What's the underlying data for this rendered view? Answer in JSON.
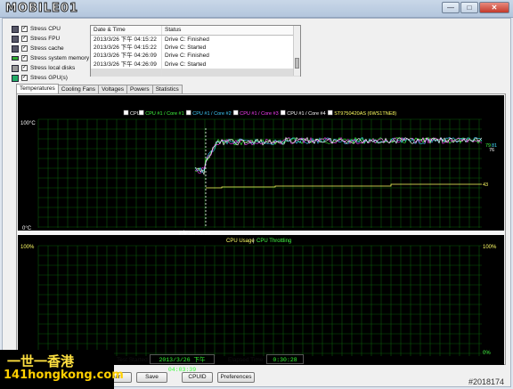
{
  "window": {
    "logo_text": "MOBILE01",
    "btn_min": "—",
    "btn_max": "□",
    "btn_close": "✕"
  },
  "stress": [
    {
      "label": "Stress CPU",
      "icon": "cpu-icon",
      "checked": true
    },
    {
      "label": "Stress FPU",
      "icon": "fpu-icon",
      "checked": true
    },
    {
      "label": "Stress cache",
      "icon": "cache-icon",
      "checked": true
    },
    {
      "label": "Stress system memory",
      "icon": "memory-icon",
      "checked": true
    },
    {
      "label": "Stress local disks",
      "icon": "disk-icon",
      "checked": true
    },
    {
      "label": "Stress GPU(s)",
      "icon": "gpu-icon",
      "checked": true
    }
  ],
  "log": {
    "headers": [
      "Date & Time",
      "Status"
    ],
    "rows": [
      [
        "2013/3/26 下午 04:15:22",
        "Drive C: Finished"
      ],
      [
        "2013/3/26 下午 04:15:22",
        "Drive C: Started"
      ],
      [
        "2013/3/26 下午 04:26:09",
        "Drive C: Finished"
      ],
      [
        "2013/3/26 下午 04:26:09",
        "Drive C: Started"
      ],
      [
        "",
        ""
      ]
    ]
  },
  "tabs": [
    "Temperatures",
    "Cooling Fans",
    "Voltages",
    "Powers",
    "Statistics"
  ],
  "temp_chart": {
    "legend": [
      {
        "label": "CPU",
        "color": "#ffffff"
      },
      {
        "label": "CPU #1 / Core #1",
        "color": "#40ff40"
      },
      {
        "label": "CPU #1 / Core #2",
        "color": "#40d0ff"
      },
      {
        "label": "CPU #1 / Core #3",
        "color": "#ff40ff"
      },
      {
        "label": "CPU #1 / Core #4",
        "color": "#ffffff"
      },
      {
        "label": "ST9750420AS (6WS1TNE8)",
        "color": "#ffff60"
      }
    ],
    "y_top": "100°C",
    "y_bottom": "0°C",
    "time_label": "下午 04:03:39",
    "val_hi_a": "79",
    "val_hi_b": "81",
    "val_mid": "76",
    "val_disk": "43"
  },
  "usage_chart": {
    "title_usage": "CPU Usage",
    "title_throttle": "CPU Throttling",
    "sep": "|",
    "y_top_left": "100%",
    "y_bottom_left": "0%",
    "y_top_right": "100%",
    "y_bottom_right": "0%",
    "color_usage": "#ffff60",
    "color_throttle": "#40ff40"
  },
  "footer": {
    "test_started_label": "Test Started:",
    "test_started_value": "2013/3/26 下午 04:03:39",
    "elapsed_label": "Elapsed Time:",
    "elapsed_value": "0:30:28",
    "btn_clear": "ear",
    "btn_save": "Save",
    "btn_cpuid": "CPUID",
    "btn_prefs": "Preferences"
  },
  "watermark": {
    "left_line1": "一世一香港",
    "left_line2": "141hongkong.com",
    "right": "#2018174"
  }
}
